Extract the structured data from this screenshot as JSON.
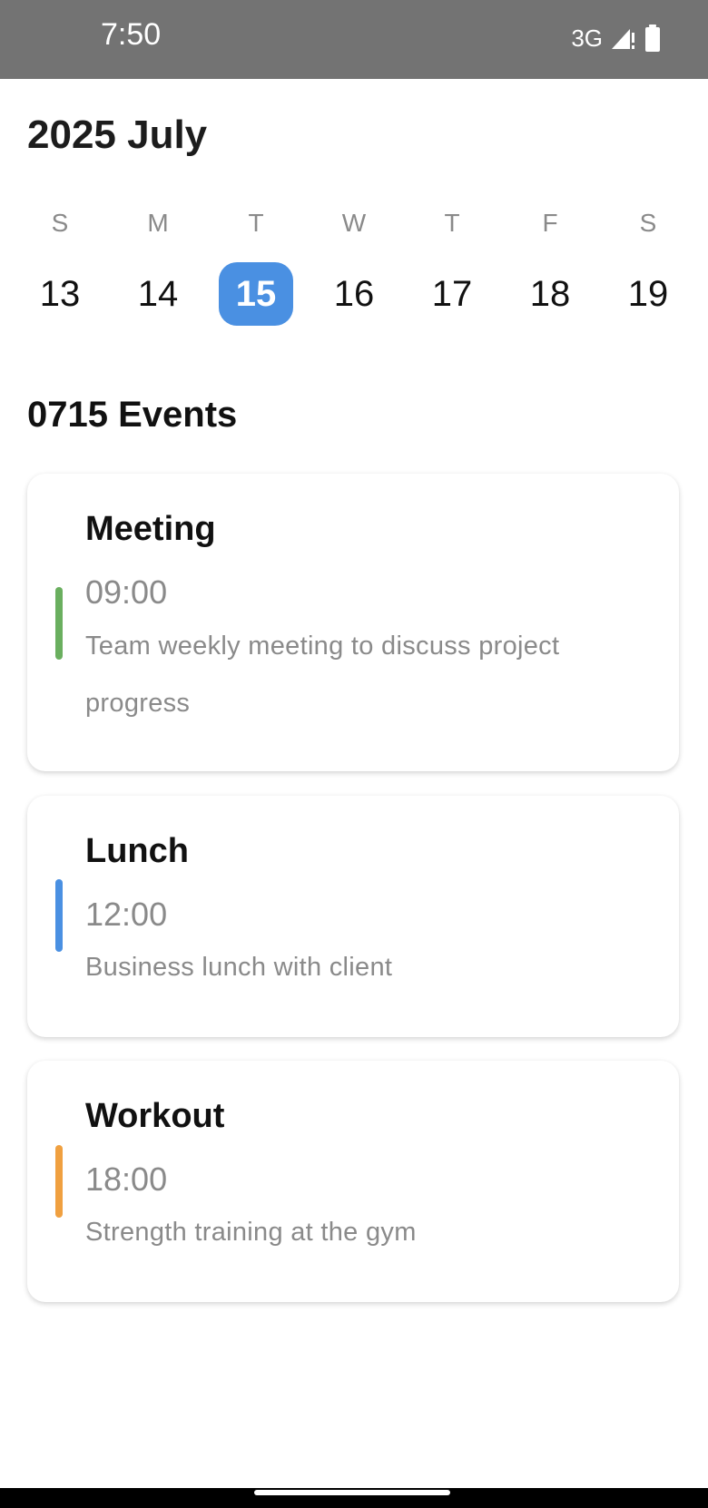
{
  "status_bar": {
    "time": "7:50",
    "network": "3G",
    "icons": [
      "signal-icon",
      "battery-icon"
    ]
  },
  "calendar": {
    "month_title": "2025 July",
    "days": [
      {
        "letter": "S",
        "number": "13",
        "selected": false
      },
      {
        "letter": "M",
        "number": "14",
        "selected": false
      },
      {
        "letter": "T",
        "number": "15",
        "selected": true
      },
      {
        "letter": "W",
        "number": "16",
        "selected": false
      },
      {
        "letter": "T",
        "number": "17",
        "selected": false
      },
      {
        "letter": "F",
        "number": "18",
        "selected": false
      },
      {
        "letter": "S",
        "number": "19",
        "selected": false
      }
    ],
    "selected_color": "#4a90e2"
  },
  "events": {
    "title": "0715 Events",
    "items": [
      {
        "title": "Meeting",
        "time": "09:00",
        "description": "Team weekly meeting to discuss project progress",
        "color": "#6aaf5f"
      },
      {
        "title": "Lunch",
        "time": "12:00",
        "description": "Business lunch with client",
        "color": "#4a90e2"
      },
      {
        "title": "Workout",
        "time": "18:00",
        "description": "Strength training at the gym",
        "color": "#f0a040"
      }
    ]
  }
}
